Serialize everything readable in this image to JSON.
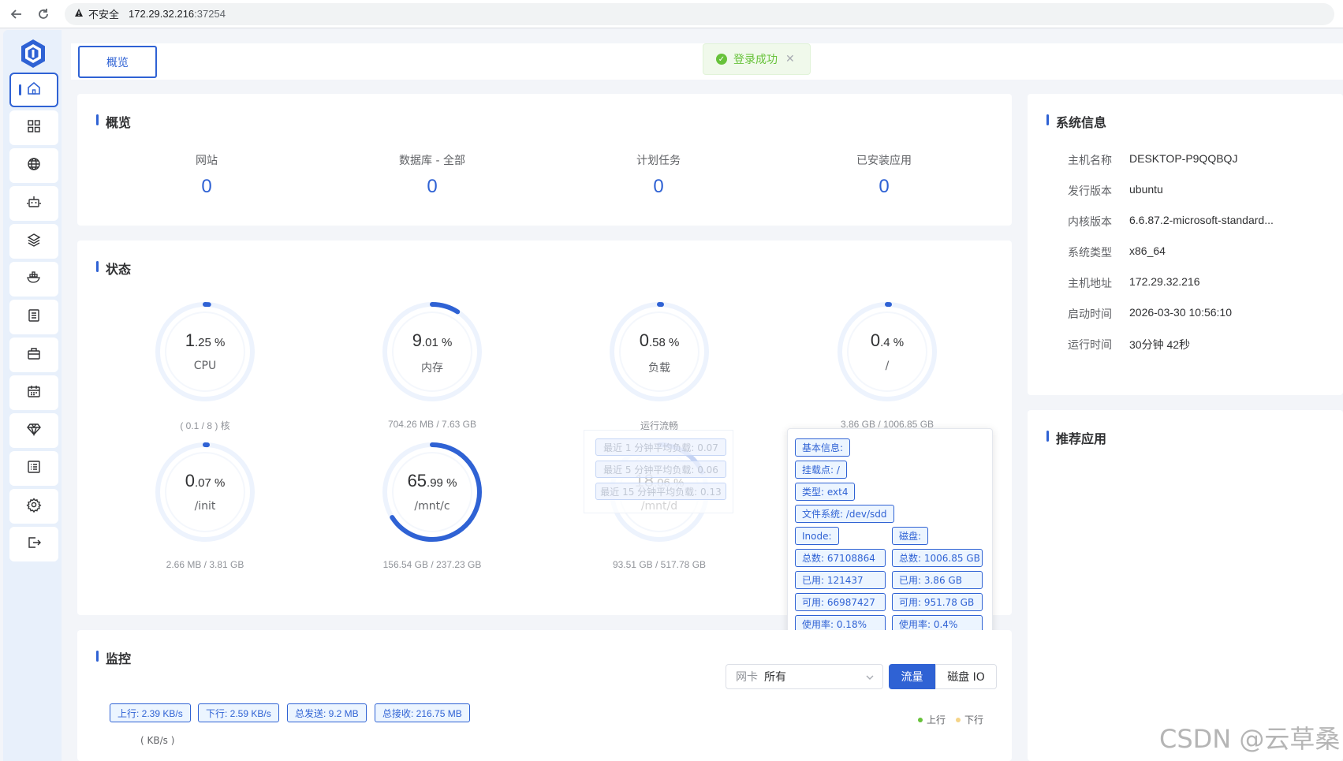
{
  "browser": {
    "insecure_label": "不安全",
    "url_host": "172.29.32.216",
    "url_port": ":37254"
  },
  "sidebar": {
    "items": [
      {
        "icon": "home-icon",
        "active": true
      },
      {
        "icon": "apps-grid-icon"
      },
      {
        "icon": "globe-icon"
      },
      {
        "icon": "robot-icon"
      },
      {
        "icon": "layers-icon"
      },
      {
        "icon": "docker-icon"
      },
      {
        "icon": "file-icon"
      },
      {
        "icon": "toolbox-icon"
      },
      {
        "icon": "calendar-icon"
      },
      {
        "icon": "diamond-icon"
      },
      {
        "icon": "log-list-icon"
      },
      {
        "icon": "settings-gear-icon"
      },
      {
        "icon": "logout-icon"
      }
    ]
  },
  "tabs": {
    "overview": "概览"
  },
  "toast": {
    "text": "登录成功"
  },
  "overview": {
    "title": "概览",
    "items": [
      {
        "label": "网站",
        "value": "0"
      },
      {
        "label": "数据库 - 全部",
        "value": "0"
      },
      {
        "label": "计划任务",
        "value": "0"
      },
      {
        "label": "已安装应用",
        "value": "0"
      }
    ]
  },
  "status": {
    "title": "状态",
    "gauges": [
      {
        "int": "1",
        "dec": ".25",
        "unit": " %",
        "name": "CPU",
        "sub": "( 0.1 / 8 ) 核",
        "percent": 1.25
      },
      {
        "int": "9",
        "dec": ".01",
        "unit": " %",
        "name": "内存",
        "sub": "704.26 MB / 7.63 GB",
        "percent": 9.01
      },
      {
        "int": "0",
        "dec": ".58",
        "unit": " %",
        "name": "负载",
        "sub": "运行流畅",
        "percent": 0.58
      },
      {
        "int": "0",
        "dec": ".4",
        "unit": " %",
        "name": "/",
        "sub": "3.86 GB / 1006.85 GB",
        "percent": 0.4
      },
      {
        "int": "0",
        "dec": ".07",
        "unit": " %",
        "name": "/init",
        "sub": "2.66 MB / 3.81 GB",
        "percent": 0.07
      },
      {
        "int": "65",
        "dec": ".99",
        "unit": " %",
        "name": "/mnt/c",
        "sub": "156.54 GB / 237.23 GB",
        "percent": 65.99
      },
      {
        "int": "18",
        "dec": ".06",
        "unit": " %",
        "name": "/mnt/d",
        "sub": "93.51 GB / 517.78 GB",
        "percent": 18.06
      }
    ],
    "load_tooltip": [
      "最近 1 分钟平均负载: 0.07",
      "最近 5 分钟平均负载: 0.06",
      "最近 15 分钟平均负载: 0.13"
    ],
    "disk_popover": {
      "basic": "基本信息:",
      "mount": "挂载点: /",
      "type": "类型: ext4",
      "fs": "文件系统: /dev/sdd",
      "inode_head": "Inode:",
      "disk_head": "磁盘:",
      "inode_total": "总数: 67108864",
      "inode_used": "已用: 121437",
      "inode_free": "可用: 66987427",
      "inode_usage": "使用率: 0.18%",
      "disk_total": "总数: 1006.85 GB",
      "disk_used": "已用: 3.86 GB",
      "disk_free": "可用: 951.78 GB",
      "disk_usage": "使用率: 0.4%"
    }
  },
  "sysinfo": {
    "title": "系统信息",
    "rows": [
      {
        "key": "主机名称",
        "value": "DESKTOP-P9QQBQJ"
      },
      {
        "key": "发行版本",
        "value": "ubuntu"
      },
      {
        "key": "内核版本",
        "value": "6.6.87.2-microsoft-standard..."
      },
      {
        "key": "系统类型",
        "value": "x86_64"
      },
      {
        "key": "主机地址",
        "value": "172.29.32.216"
      },
      {
        "key": "启动时间",
        "value": "2026-03-30 10:56:10"
      },
      {
        "key": "运行时间",
        "value": "30分钟 42秒"
      }
    ]
  },
  "recommend": {
    "title": "推荐应用"
  },
  "monitor": {
    "title": "监控",
    "nic_prefix": "网卡",
    "nic_value": "所有",
    "seg_traffic": "流量",
    "seg_disk": "磁盘 IO",
    "tags": [
      "上行: 2.39 KB/s",
      "下行: 2.59 KB/s",
      "总发送: 9.2 MB",
      "总接收: 216.75 MB"
    ],
    "legend_up": "上行",
    "legend_down": "下行",
    "legend_up_color": "#67c23a",
    "legend_down_color": "#f5d488",
    "unit": "( KB/s )"
  },
  "watermark": "CSDN @云草桑",
  "colors": {
    "accent": "#2f62d4",
    "success": "#67c23a"
  }
}
